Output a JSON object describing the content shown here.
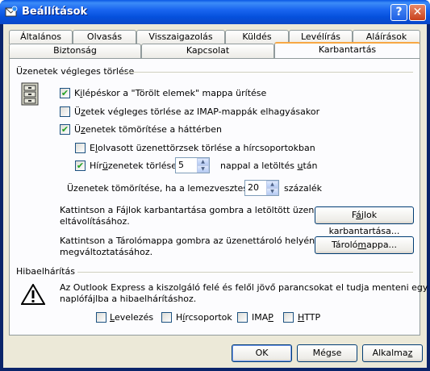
{
  "window": {
    "title": "Beállítások",
    "help_glyph": "?",
    "close_glyph": "✕"
  },
  "tabs_row1": [
    "Általános",
    "Olvasás",
    "Visszaigazolás",
    "Küldés",
    "Levélírás",
    "Aláírások"
  ],
  "tabs_row2": [
    "Biztonság",
    "Kapcsolat",
    "Karbantartás"
  ],
  "active_tab": "Karbantartás",
  "delete_section": {
    "heading": "Üzenetek végleges törlése",
    "empty_deleted_pre": "K",
    "empty_deleted_acc": "i",
    "empty_deleted_post": "lépéskor a \"Törölt elemek\" mappa ürítése",
    "empty_deleted_checked": true,
    "purge_imap_pre": "Ü",
    "purge_imap_acc": "z",
    "purge_imap_post": "etek végleges törlése az IMAP-mappák elhagyásakor",
    "purge_imap_checked": false,
    "compact_pre": "Ü",
    "compact_acc": "z",
    "compact_post": "enetek tömörítése a háttérben",
    "compact_checked": true,
    "delete_read_pre": "E",
    "delete_read_acc": "l",
    "delete_read_post": "olvasott üzenettörzsek törlése a hírcsoportokban",
    "delete_read_checked": false,
    "delete_news_pre": "Hír",
    "delete_news_acc": "ü",
    "delete_news_post": "zenetek törlése",
    "delete_news_checked": true,
    "delete_news_days": "5",
    "delete_news_suffix_pre": "nappal a letöltés ",
    "delete_news_suffix_acc": "u",
    "delete_news_suffix_post": "tán",
    "compact_when_label": "Üzenetek tömörítése, ha a lemezveszteség",
    "compact_when_value": "20",
    "compact_when_suffix": "százalék",
    "cleanup_text1": "Kattintson a Fájlok karbantartása gombra a letöltött üzenetek",
    "cleanup_text2": "eltávolításához.",
    "cleanup_button_pre": "F",
    "cleanup_button_acc": "á",
    "cleanup_button_post": "jlok karbantartása...",
    "store_text1": "Kattintson a Tárolómappa gombra az üzenettároló helyének",
    "store_text2": "megváltoztatásához.",
    "store_button_pre": "Tároló",
    "store_button_acc": "m",
    "store_button_post": "appa..."
  },
  "troubleshoot_section": {
    "heading": "Hibaelhárítás",
    "text1": "Az Outlook Express a kiszolgáló felé és felől jövő parancsokat el tudja menteni egy",
    "text2": "naplófájlba a hibaelhárításhoz.",
    "options": [
      {
        "pre": "",
        "acc": "L",
        "post": "evelezés",
        "checked": false
      },
      {
        "pre": "H",
        "acc": "í",
        "post": "rcsoportok",
        "checked": false
      },
      {
        "pre": "IMA",
        "acc": "P",
        "post": "",
        "checked": false
      },
      {
        "pre": "",
        "acc": "H",
        "post": "TTP",
        "checked": false
      }
    ]
  },
  "footer": {
    "ok": "OK",
    "cancel": "Mégse",
    "apply_pre": "Alkalma",
    "apply_acc": "z",
    "apply_post": ""
  },
  "colors": {
    "title_bar": "#0a58e4",
    "accent_tab": "#f7a844",
    "dialog_bg": "#ece9d8"
  },
  "icons": [
    "outlook-express-icon",
    "cabinet-icon",
    "warning-icon",
    "check-icon"
  ]
}
